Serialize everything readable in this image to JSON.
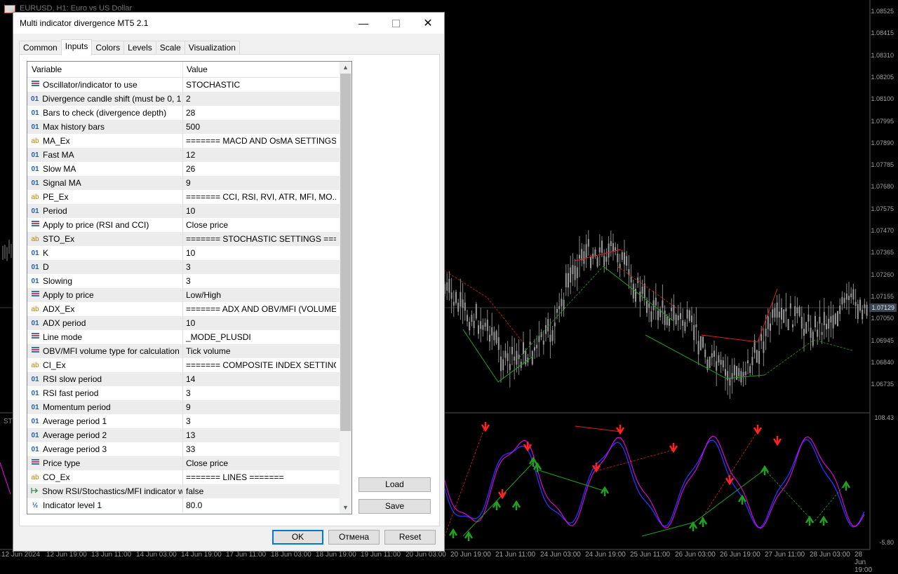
{
  "chart": {
    "window_title": "EURUSD, H1:  Euro vs US Dollar",
    "current_price": "1.07129",
    "osc_title": "ST",
    "price_labels": [
      "1.08525",
      "1.08415",
      "1.08310",
      "1.08205",
      "1.08100",
      "1.07995",
      "1.07890",
      "1.07785",
      "1.07680",
      "1.07575",
      "1.07470",
      "1.07365",
      "1.07260",
      "1.07155",
      "1.07050",
      "1.06945",
      "1.06840",
      "1.06735"
    ],
    "osc_labels": [
      "108.43",
      "-5.80"
    ],
    "time_labels": [
      "12 Jun 2024",
      "12 Jun 19:00",
      "13 Jun 11:00",
      "14 Jun 03:00",
      "14 Jun 19:00",
      "17 Jun 11:00",
      "18 Jun 03:00",
      "18 Jun 19:00",
      "19 Jun 11:00",
      "20 Jun 03:00",
      "20 Jun 19:00",
      "21 Jun 11:00",
      "24 Jun 03:00",
      "24 Jun 19:00",
      "25 Jun 11:00",
      "26 Jun 03:00",
      "26 Jun 19:00",
      "27 Jun 11:00",
      "28 Jun 03:00",
      "28 Jun 19:00"
    ]
  },
  "dialog": {
    "title": "Multi indicator divergence MT5 2.1",
    "tabs": [
      "Common",
      "Inputs",
      "Colors",
      "Levels",
      "Scale",
      "Visualization"
    ],
    "active_tab": "Inputs",
    "grid": {
      "header_variable": "Variable",
      "header_value": "Value",
      "rows": [
        {
          "type": "enum",
          "variable": "Oscillator/indicator to use",
          "value": "STOCHASTIC"
        },
        {
          "type": "int",
          "variable": "Divergence candle shift (must be 0, 1 ...",
          "value": "2"
        },
        {
          "type": "int",
          "variable": "Bars to check (divergence depth)",
          "value": "28"
        },
        {
          "type": "int",
          "variable": "Max history bars",
          "value": "500"
        },
        {
          "type": "str",
          "variable": "MA_Ex",
          "value": "======= MACD AND OsMA SETTINGS ..."
        },
        {
          "type": "int",
          "variable": "Fast MA",
          "value": "12"
        },
        {
          "type": "int",
          "variable": "Slow MA",
          "value": "26"
        },
        {
          "type": "int",
          "variable": "Signal MA",
          "value": "9"
        },
        {
          "type": "str",
          "variable": "PE_Ex",
          "value": "======= CCI, RSI, RVI, ATR, MFI, MO..."
        },
        {
          "type": "int",
          "variable": "Period",
          "value": "10"
        },
        {
          "type": "enum",
          "variable": "Apply to price (RSI and CCI)",
          "value": "Close price"
        },
        {
          "type": "str",
          "variable": "STO_Ex",
          "value": "======= STOCHASTIC SETTINGS ===..."
        },
        {
          "type": "int",
          "variable": "K",
          "value": "10"
        },
        {
          "type": "int",
          "variable": "D",
          "value": "3"
        },
        {
          "type": "int",
          "variable": "Slowing",
          "value": "3"
        },
        {
          "type": "enum",
          "variable": "Apply to price",
          "value": "Low/High"
        },
        {
          "type": "str",
          "variable": "ADX_Ex",
          "value": "======= ADX AND OBV/MFI (VOLUME) ..."
        },
        {
          "type": "int",
          "variable": "ADX period",
          "value": "10"
        },
        {
          "type": "enum",
          "variable": "Line mode",
          "value": "_MODE_PLUSDI"
        },
        {
          "type": "enum",
          "variable": "OBV/MFI volume type for calculation",
          "value": "Tick volume"
        },
        {
          "type": "str",
          "variable": "CI_Ex",
          "value": "======= COMPOSITE INDEX SETTINGS..."
        },
        {
          "type": "int",
          "variable": "RSI slow period",
          "value": "14"
        },
        {
          "type": "int",
          "variable": "RSI fast period",
          "value": "3"
        },
        {
          "type": "int",
          "variable": "Momentum period",
          "value": "9"
        },
        {
          "type": "int",
          "variable": "Average period 1",
          "value": "3"
        },
        {
          "type": "int",
          "variable": "Average period 2",
          "value": "13"
        },
        {
          "type": "int",
          "variable": "Average period 3",
          "value": "33"
        },
        {
          "type": "enum",
          "variable": "Price type",
          "value": "Close price"
        },
        {
          "type": "str",
          "variable": "CO_Ex",
          "value": "======= LINES ======="
        },
        {
          "type": "bool",
          "variable": "Show RSI/Stochastics/MFI indicator wi...",
          "value": "false"
        },
        {
          "type": "dbl",
          "variable": "Indicator level 1",
          "value": "80.0"
        }
      ]
    },
    "buttons": {
      "load": "Load",
      "save": "Save",
      "ok": "OK",
      "cancel": "Отмена",
      "reset": "Reset"
    },
    "icon_glyphs": {
      "int": "01",
      "str": "ab",
      "dbl": "½"
    }
  },
  "colors": {
    "accent": "#0078d7",
    "bear_arrow": "#ff2020",
    "bull_arrow": "#20a020",
    "stoch_main": "#ff00ff",
    "stoch_signal": "#3030ff"
  }
}
